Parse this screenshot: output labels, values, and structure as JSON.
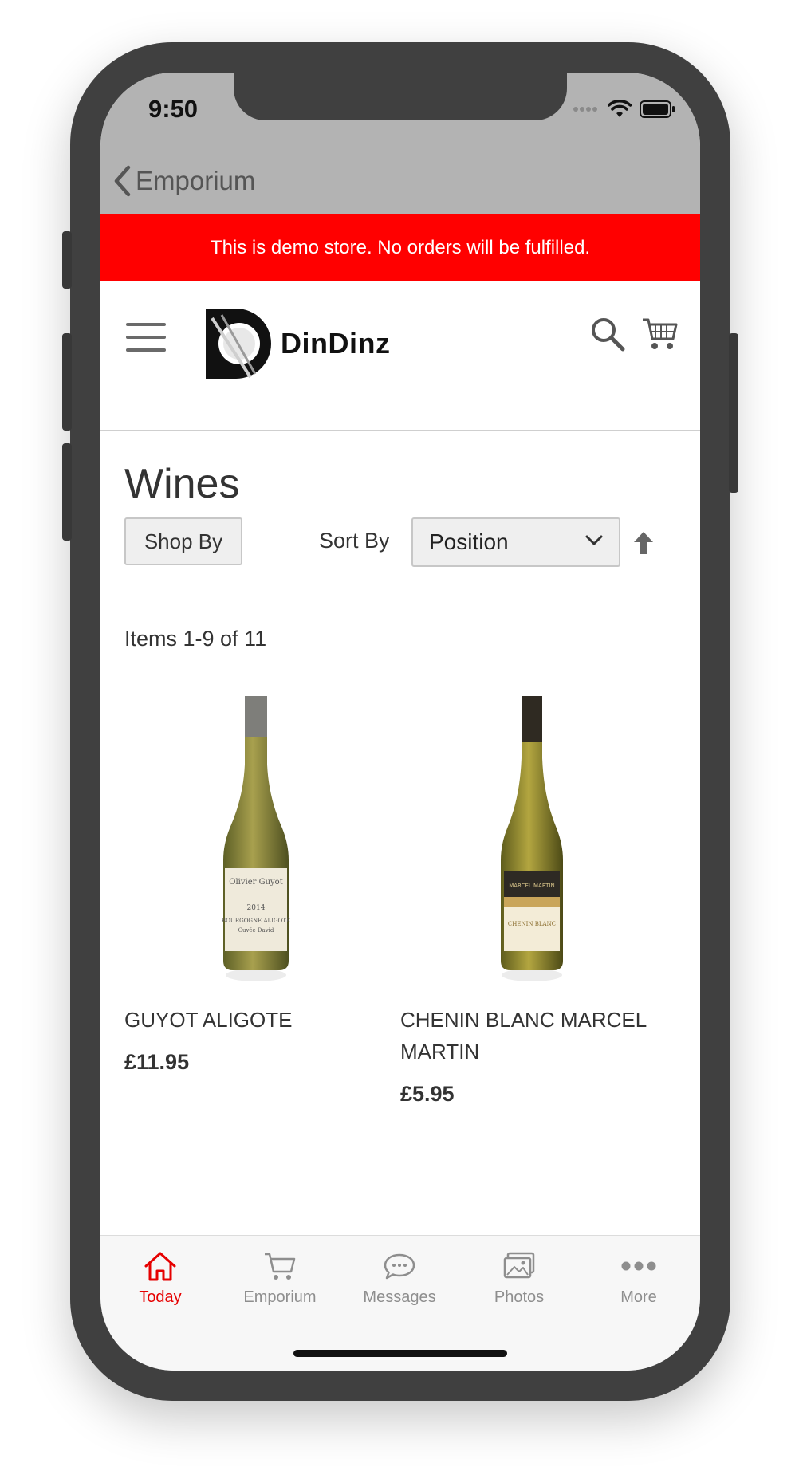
{
  "status_bar": {
    "time": "9:50"
  },
  "nav": {
    "back_label": "Emporium"
  },
  "banner": {
    "text": "This is demo store. No orders will be fulfilled.",
    "color": "#ff0000"
  },
  "header": {
    "logo_text": "DinDinz",
    "icons": [
      "menu-icon",
      "search-icon",
      "cart-icon"
    ]
  },
  "page": {
    "title": "Wines",
    "shop_by_label": "Shop By",
    "sort_label": "Sort By",
    "sort_value": "Position",
    "items_count": "Items 1-9 of 11"
  },
  "products": [
    {
      "name": "GUYOT ALIGOTE",
      "price": "£11.95"
    },
    {
      "name": "CHENIN BLANC MARCEL MARTIN",
      "price": "£5.95"
    }
  ],
  "tabbar": {
    "accent": "#e60000",
    "tabs": [
      {
        "label": "Today",
        "icon": "home-icon",
        "active": true
      },
      {
        "label": "Emporium",
        "icon": "cart-icon",
        "active": false
      },
      {
        "label": "Messages",
        "icon": "chat-icon",
        "active": false
      },
      {
        "label": "Photos",
        "icon": "photos-icon",
        "active": false
      },
      {
        "label": "More",
        "icon": "more-icon",
        "active": false
      }
    ]
  }
}
